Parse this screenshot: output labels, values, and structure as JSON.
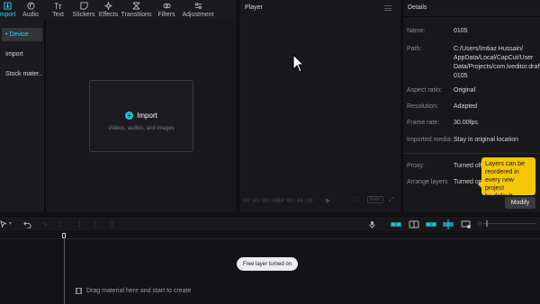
{
  "media_toolbar": {
    "tools": [
      {
        "label": "mport",
        "icon": "import-icon",
        "active": true
      },
      {
        "label": "Audio",
        "icon": "audio-icon"
      },
      {
        "label": "Text",
        "icon": "text-icon"
      },
      {
        "label": "Stickers",
        "icon": "stickers-icon"
      },
      {
        "label": "Effects",
        "icon": "effects-icon"
      },
      {
        "label": "Transitions",
        "icon": "transitions-icon"
      },
      {
        "label": "Filters",
        "icon": "filters-icon"
      },
      {
        "label": "Adjustment",
        "icon": "adjustment-icon"
      }
    ]
  },
  "media_sidebar": {
    "items": [
      {
        "label": "• Device"
      },
      {
        "label": "Import"
      },
      {
        "label": "Stock mater..."
      }
    ]
  },
  "media_panel": {
    "import_label": "Import",
    "import_hint": "Videos, audios, and images"
  },
  "player": {
    "title": "Player",
    "current_time": "00:00:00:00",
    "total_time": "00:00:00:00",
    "ratio_label": "Ratio"
  },
  "details": {
    "title": "Details",
    "rows": [
      {
        "key": "Name:",
        "value": "0105"
      },
      {
        "key": "Path:",
        "lines": [
          "C:/Users/Imtiaz Hussain/",
          "AppData/Local/CapCut/User",
          "Data/Projects/com.lveditor.draft/",
          "0105"
        ]
      },
      {
        "key": "Aspect ratio:",
        "value": "Original"
      },
      {
        "key": "Resolution:",
        "value": "Adapted"
      },
      {
        "key": "Frame rate:",
        "value": "30.00fps"
      },
      {
        "key": "Imported media:",
        "value": "Stay in original location"
      },
      {
        "key": "Proxy:",
        "value": "Turned off"
      },
      {
        "key": "Arrange layers",
        "value": "Turned on"
      }
    ],
    "tooltip_lines": [
      "Layers can be",
      "reordered in",
      "every new project",
      "by default."
    ],
    "modify_label": "Modify"
  },
  "timeline": {
    "toast": "Free layer turned on",
    "drag_hint": "Drag material here and start to create"
  },
  "colors": {
    "accent": "#2bd4e8",
    "tooltip": "#f6c60b",
    "panel": "#18181b",
    "background": "#111114"
  }
}
